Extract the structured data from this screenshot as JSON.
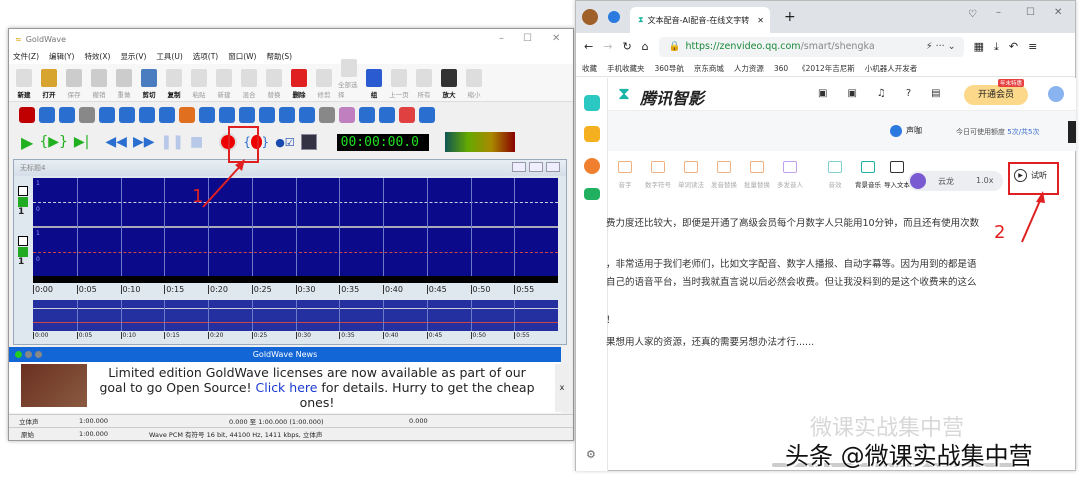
{
  "goldwave": {
    "title": "GoldWave",
    "menu": [
      "文件(Z)",
      "编辑(Y)",
      "特效(X)",
      "显示(V)",
      "工具(U)",
      "选项(T)",
      "窗口(W)",
      "帮助(S)"
    ],
    "toolbar": [
      {
        "label": "新建",
        "on": true,
        "color": "#ddd"
      },
      {
        "label": "打开",
        "on": true,
        "color": "#d8a430"
      },
      {
        "label": "保存",
        "on": false,
        "color": "#ccc"
      },
      {
        "label": "撤销",
        "on": false,
        "color": "#ccc"
      },
      {
        "label": "重做",
        "on": false,
        "color": "#ccc"
      },
      {
        "label": "剪切",
        "on": true,
        "color": "#4a7cc0"
      },
      {
        "label": "复制",
        "on": true,
        "color": "#ddd"
      },
      {
        "label": "粘贴",
        "on": false,
        "color": "#ddd"
      },
      {
        "label": "新建",
        "on": false,
        "color": "#ddd"
      },
      {
        "label": "混合",
        "on": false,
        "color": "#ddd"
      },
      {
        "label": "替换",
        "on": false,
        "color": "#ddd"
      },
      {
        "label": "删除",
        "on": true,
        "color": "#e02020"
      },
      {
        "label": "修剪",
        "on": false,
        "color": "#ddd"
      },
      {
        "label": "全部选择",
        "on": false,
        "color": "#ddd"
      },
      {
        "label": "组",
        "on": true,
        "color": "#2a5bd0"
      },
      {
        "label": "上一页",
        "on": false,
        "color": "#ddd"
      },
      {
        "label": "所有",
        "on": false,
        "color": "#ddd"
      },
      {
        "label": "放大",
        "on": true,
        "color": "#333"
      },
      {
        "label": "缩小",
        "on": false,
        "color": "#ddd"
      }
    ],
    "effects_icons": [
      "#c00000",
      "#2a6fd0",
      "#2a6fd0",
      "#888",
      "#2a6fd0",
      "#2a6fd0",
      "#2a6fd0",
      "#2a6fd0",
      "#e07020",
      "#2a6fd0",
      "#2a6fd0",
      "#2a6fd0",
      "#2a6fd0",
      "#2a6fd0",
      "#2a6fd0",
      "#888",
      "#c080c0",
      "#2a6fd0",
      "#2a6fd0",
      "#e04040",
      "#2a6fd0"
    ],
    "time_display": "00:00:00.0",
    "document_title": "无标题4",
    "channel_scale": [
      "1",
      "0",
      "1",
      "0"
    ],
    "channel_number": "1",
    "timeline": [
      "0:00",
      "0:05",
      "0:10",
      "0:15",
      "0:20",
      "0:25",
      "0:30",
      "0:35",
      "0:40",
      "0:45",
      "0:50",
      "0:55"
    ],
    "news": {
      "title": "GoldWave News",
      "text_before": "Limited edition GoldWave licenses are now available as part of our goal to go Open Source! ",
      "link": "Click here",
      "text_after": " for details. Hurry to get the cheap ones!",
      "close": "x"
    },
    "status1": [
      "立体声",
      "1:00.000",
      "0.000 至 1:00.000 (1:00.000)",
      "0.000"
    ],
    "status2": [
      "原始",
      "1:00.000",
      "Wave PCM 有符号 16 bit, 44100 Hz, 1411 kbps, 立体声"
    ]
  },
  "browser": {
    "tab_title": "文本配音-AI配音-在线文字转",
    "url_host": "https://zenvideo.qq.com",
    "url_path": "/smart/shengka",
    "bookmarks": [
      "收藏",
      "手机收藏夹",
      "360导航",
      "京东商城",
      "人力资源",
      "360",
      "《2012年吉尼斯",
      "小机器人开发者"
    ],
    "brand": "腾讯智影",
    "vip_button": "开通会员",
    "vip_badge": "年末特惠",
    "shengka": "声咖",
    "quota_label": "今日可使用额度 ",
    "quota_value": "5次/共5次",
    "tools": [
      "音字",
      "数字符号",
      "单词读法",
      "发音替换",
      "批量替换",
      "多发音人",
      "音效",
      "背景音乐",
      "导入文本"
    ],
    "voice": "云龙",
    "speed": "1.0x",
    "preview": "试听",
    "lines": [
      "费力度还比较大，即便是开通了高级会员每个月数字人只能用10分钟，而且还有使用次数",
      "，非常适用于我们老师们，比如文字配音、数字人播报、自动字幕等。因为用到的都是语",
      "自己的语音平台，当时我就直言说以后必然会收费。但让我没料到的是这个收费来的这么",
      "！",
      "果想用人家的资源，还真的需要另想办法才行......"
    ]
  },
  "annotations": [
    "1",
    "2"
  ],
  "watermark": {
    "wechat": "微课实战集中营",
    "toutiao": "头条 @微课实战集中营"
  }
}
